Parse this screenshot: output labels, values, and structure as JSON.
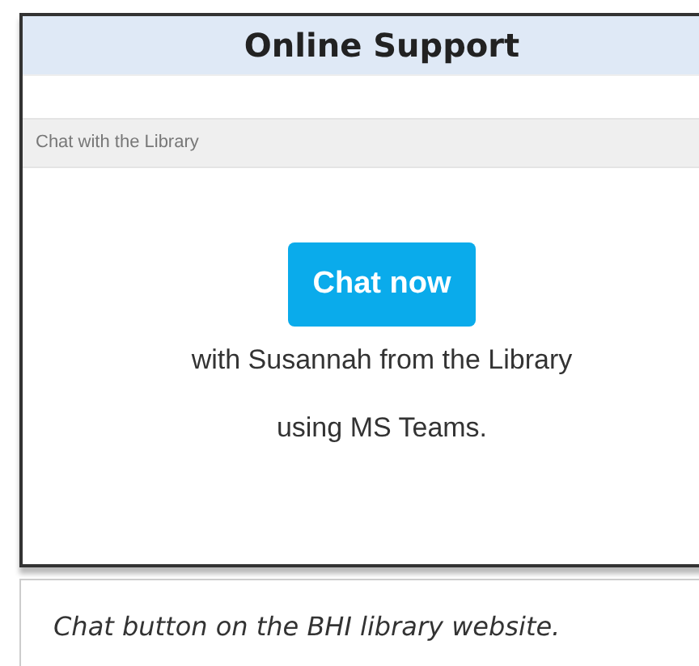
{
  "widget": {
    "title": "Online Support",
    "section": "Chat with the Library",
    "button": "Chat now",
    "description_lines": [
      "with Susannah from the Library",
      "using MS Teams."
    ]
  },
  "caption": "Chat button on the BHI library website."
}
